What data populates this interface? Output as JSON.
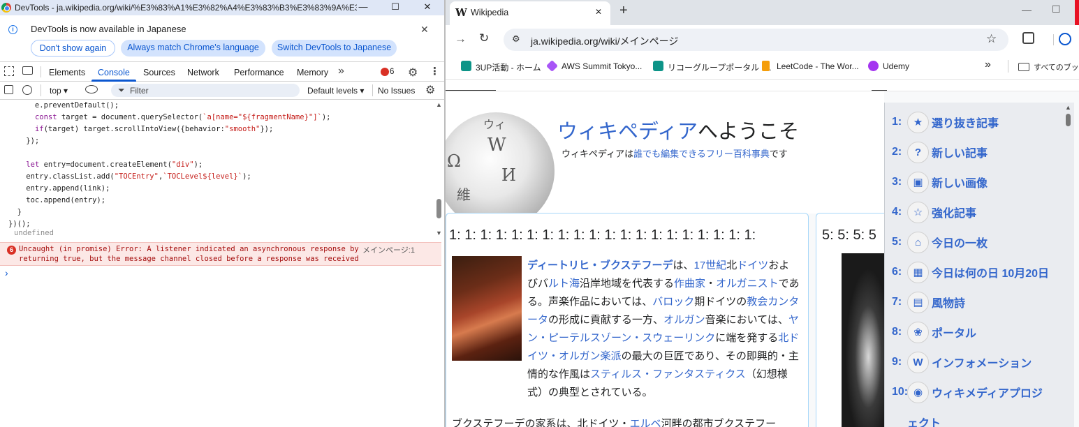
{
  "devtools": {
    "title": "DevTools - ja.wikipedia.org/wiki/%E3%83%A1%E3%82%A4%E3%83%B3%E3%83%9A%E3...",
    "window_controls": {
      "minimize": "—",
      "maximize": "☐",
      "close": "✕"
    },
    "infobar": {
      "message": "DevTools is now available in Japanese",
      "buttons": [
        "Don't show again",
        "Always match Chrome's language",
        "Switch DevTools to Japanese"
      ],
      "close": "✕"
    },
    "tabs": [
      "Elements",
      "Console",
      "Sources",
      "Network",
      "Performance",
      "Memory"
    ],
    "active_tab": "Console",
    "more_tabs": "»",
    "error_count": "6",
    "console_bar": {
      "context": "top ▾",
      "filter_placeholder": "Filter",
      "levels": "Default levels ▾",
      "issues": "No Issues"
    },
    "code_lines": [
      "      e.preventDefault();",
      "      const target = document.querySelector(`a[name=\"${fragmentName}\"]`);",
      "      if(target) target.scrollIntoView({behavior:\"smooth\"});",
      "    });",
      "",
      "    let entry=document.createElement(\"div\");",
      "    entry.classList.add(\"TOCEntry\",`TOCLevel${level}`);",
      "    entry.append(link);",
      "    toc.append(entry);",
      "  }",
      "})();"
    ],
    "result": "undefined",
    "error": {
      "badge": "6",
      "line1": "Uncaught (in promise) Error: A listener indicated an asynchronous response by",
      "line2": "returning true, but the message channel closed before a response was received",
      "source": "メインページ:1"
    },
    "prompt": "›"
  },
  "browser": {
    "tab_title": "Wikipedia",
    "tab_favicon": "W",
    "tab_close": "✕",
    "new_tab": "+",
    "window_controls": {
      "minimize": "—",
      "maximize": "☐"
    },
    "url": "ja.wikipedia.org/wiki/メインページ",
    "bookmarks": [
      "3UP活動 - ホーム",
      "AWS Summit Tokyo...",
      "リコーグループポータル -...",
      "LeetCode - The Wor...",
      "Udemy"
    ],
    "bookmarks_more": "»",
    "all_bookmarks": "すべてのブックマ"
  },
  "wiki": {
    "welcome_title_link": "ウィキペディア",
    "welcome_title_rest": "へようこそ",
    "tagline_1": "ウィキペディアは",
    "tagline_link": "誰でも編集できるフリー百科事典",
    "tagline_2": "です",
    "globe_glyphs": [
      "ウィ",
      "W",
      "Ω",
      "И",
      "維"
    ],
    "box_a_heading": "1: 1: 1: 1: 1: 1: 1: 1: 1: 1: 1: 1: 1: 1: 1: 1: 1: 1: 1: 1:",
    "box_b_heading": "5: 5: 5: 5",
    "article": [
      {
        "t": "ディートリヒ・ブクステフーデ",
        "l": true,
        "b": true
      },
      {
        "t": "は、",
        "l": false
      },
      {
        "t": "17世紀",
        "l": true
      },
      {
        "t": "北",
        "l": false
      },
      {
        "t": "ドイツ",
        "l": true
      },
      {
        "t": "およびバ",
        "l": false
      },
      {
        "t": "ルト海",
        "l": true
      },
      {
        "t": "沿岸地域を代表する",
        "l": false
      },
      {
        "t": "作曲家",
        "l": true
      },
      {
        "t": "・",
        "l": false
      },
      {
        "t": "オルガニスト",
        "l": true
      },
      {
        "t": "である。声楽作品においては、",
        "l": false
      },
      {
        "t": "バロック",
        "l": true
      },
      {
        "t": "期ドイツの",
        "l": false
      },
      {
        "t": "教会カンタータ",
        "l": true
      },
      {
        "t": "の形成に貢献する一方、",
        "l": false
      },
      {
        "t": "オルガン",
        "l": true
      },
      {
        "t": "音楽においては、",
        "l": false
      },
      {
        "t": "ヤン・ピーテルスゾーン・スウェーリンク",
        "l": true
      },
      {
        "t": "に端を発する",
        "l": false
      },
      {
        "t": "北ドイツ・オルガン楽派",
        "l": true
      },
      {
        "t": "の最大の巨匠であり、その即興的・主情的な作風は",
        "l": false
      },
      {
        "t": "スティルス・ファンタスティクス",
        "l": true
      },
      {
        "t": "（幻想様式）の典型とされている。",
        "l": false
      }
    ],
    "article_next": "ブクステフーデの家系は、北ドイツ・",
    "article_next_link": "エルベ",
    "article_next_rest": "河畔の都市ブクステフー",
    "sidebar": [
      {
        "num": "1:",
        "icon": "star-icon",
        "glyph": "★",
        "label": "選り抜き記事"
      },
      {
        "num": "2:",
        "icon": "question-icon",
        "glyph": "?",
        "label": "新しい記事"
      },
      {
        "num": "3:",
        "icon": "image-icon",
        "glyph": "▣",
        "label": "新しい画像"
      },
      {
        "num": "4:",
        "icon": "silver-star-icon",
        "glyph": "☆",
        "label": "強化記事"
      },
      {
        "num": "5:",
        "icon": "museum-icon",
        "glyph": "⌂",
        "label": "今日の一枚"
      },
      {
        "num": "6:",
        "icon": "calendar-icon",
        "glyph": "▦",
        "label": "今日は何の日 10月20日"
      },
      {
        "num": "7:",
        "icon": "newspaper-icon",
        "glyph": "▤",
        "label": "風物詩"
      },
      {
        "num": "8:",
        "icon": "portal-icon",
        "glyph": "❀",
        "label": "ポータル"
      },
      {
        "num": "9:",
        "icon": "wikipedia-w-icon",
        "glyph": "W",
        "label": "インフォメーション"
      },
      {
        "num": "10:",
        "icon": "wikimedia-icon",
        "glyph": "◉",
        "label": "ウィキメディアプロジ"
      },
      {
        "num": "",
        "icon": "",
        "glyph": "",
        "label": "ェクト"
      }
    ]
  }
}
